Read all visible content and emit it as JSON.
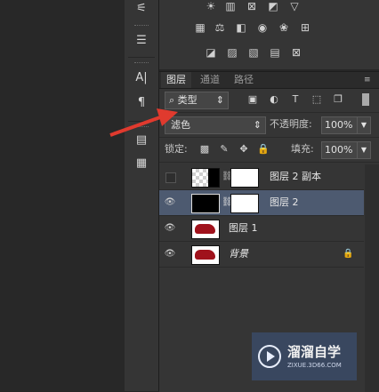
{
  "panel_tabs": [
    "图层",
    "通道",
    "路径"
  ],
  "filter": {
    "kind_label": "类型"
  },
  "blend": {
    "mode": "滤色",
    "opacity_label": "不透明度:",
    "opacity_value": "100%"
  },
  "lock": {
    "label": "锁定:",
    "fill_label": "填充:",
    "fill_value": "100%"
  },
  "layers": [
    {
      "name": "图层 2 副本",
      "visible": false,
      "selected": false
    },
    {
      "name": "图层 2",
      "visible": true,
      "selected": true
    },
    {
      "name": "图层 1",
      "visible": true,
      "selected": false
    },
    {
      "name": "背景",
      "visible": true,
      "selected": false,
      "locked": true
    }
  ],
  "watermark": {
    "title": "溜溜自学",
    "url": "ZIXUE.3D66.COM"
  },
  "colors": {
    "panel_bg": "#353535",
    "selected_row": "#4d5a70",
    "arrow": "#e03a2e"
  }
}
